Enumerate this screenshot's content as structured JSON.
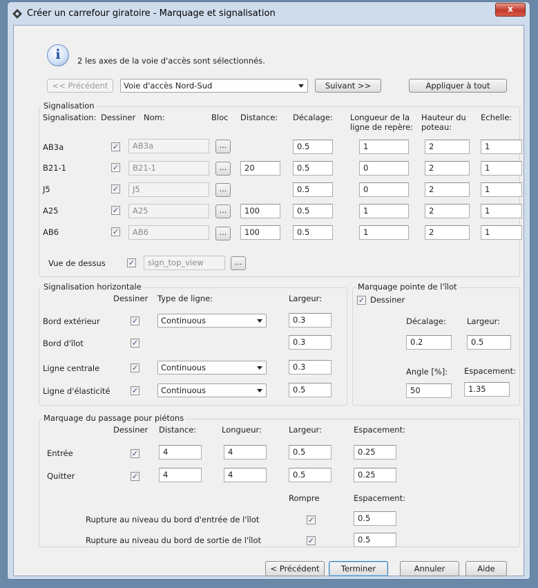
{
  "window": {
    "title": "Créer un carrefour giratoire - Marquage et signalisation",
    "close_label": "x"
  },
  "info": {
    "text": "2 les axes de la voie d'accès sont sélectionnés."
  },
  "nav": {
    "prev_label": "<< Précédent",
    "road_select": "Voie d'accès Nord-Sud",
    "next_label": "Suivant >>",
    "apply_all_label": "Appliquer à tout"
  },
  "signalisation": {
    "title": "Signalisation",
    "headers": {
      "sign": "Signalisation:",
      "draw": "Dessiner",
      "name": "Nom:",
      "block": "Bloc",
      "distance": "Distance:",
      "offset": "Décalage:",
      "leader": "Longueur de la ligne de repère:",
      "pole": "Hauteur du poteau:",
      "scale": "Echelle:"
    },
    "rows": [
      {
        "label": "AB3a",
        "checked": true,
        "name": "AB3a",
        "distance": "",
        "offset": "0.5",
        "leader": "1",
        "pole": "2",
        "scale": "1"
      },
      {
        "label": "B21-1",
        "checked": true,
        "name": "B21-1",
        "distance": "20",
        "offset": "0.5",
        "leader": "0",
        "pole": "2",
        "scale": "1"
      },
      {
        "label": "J5",
        "checked": true,
        "name": "J5",
        "distance": "",
        "offset": "0.5",
        "leader": "0",
        "pole": "2",
        "scale": "1"
      },
      {
        "label": "A25",
        "checked": true,
        "name": "A25",
        "distance": "100",
        "offset": "0.5",
        "leader": "1",
        "pole": "2",
        "scale": "1"
      },
      {
        "label": "AB6",
        "checked": true,
        "name": "AB6",
        "distance": "100",
        "offset": "0.5",
        "leader": "1",
        "pole": "2",
        "scale": "1"
      }
    ],
    "top_view": {
      "label": "Vue de dessus",
      "checked": true,
      "value": "sign_top_view"
    }
  },
  "horizontal": {
    "title": "Signalisation horizontale",
    "headers": {
      "draw": "Dessiner",
      "line_type": "Type de ligne:",
      "width": "Largeur:"
    },
    "rows": [
      {
        "label": "Bord extérieur",
        "checked": true,
        "line_type": "Continuous",
        "width": "0.3"
      },
      {
        "label": "Bord d'îlot",
        "checked": true,
        "line_type": "",
        "width": "0.3"
      },
      {
        "label": "Ligne centrale",
        "checked": true,
        "line_type": "Continuous",
        "width": "0.3"
      },
      {
        "label": "Ligne d'élasticité",
        "checked": true,
        "line_type": "Continuous",
        "width": "0.5"
      }
    ]
  },
  "island_tip": {
    "title": "Marquage pointe de l'îlot",
    "draw_label": "Dessiner",
    "checked": true,
    "offset_label": "Décalage:",
    "offset": "0.2",
    "width_label": "Largeur:",
    "width": "0.5",
    "angle_label": "Angle [%]:",
    "angle": "50",
    "spacing_label": "Espacement:",
    "spacing": "1.35"
  },
  "crosswalk": {
    "title": "Marquage du passage pour piétons",
    "headers": {
      "draw": "Dessiner",
      "distance": "Distance:",
      "length": "Longueur:",
      "width": "Largeur:",
      "spacing": "Espacement:"
    },
    "rows": [
      {
        "label": "Entrée",
        "checked": true,
        "distance": "4",
        "length": "4",
        "width": "0.5",
        "spacing": "0.25"
      },
      {
        "label": "Quitter",
        "checked": true,
        "distance": "4",
        "length": "4",
        "width": "0.5",
        "spacing": "0.25"
      }
    ],
    "break_headers": {
      "break": "Rompre",
      "spacing": "Espacement:"
    },
    "breaks": [
      {
        "label": "Rupture au niveau du bord d'entrée de l'îlot",
        "checked": true,
        "spacing": "0.5"
      },
      {
        "label": "Rupture au niveau du bord de sortie de l'îlot",
        "checked": true,
        "spacing": "0.5"
      }
    ]
  },
  "footer": {
    "prev_label": "< Précédent",
    "finish_label": "Terminer",
    "cancel_label": "Annuler",
    "help_label": "Aide"
  }
}
